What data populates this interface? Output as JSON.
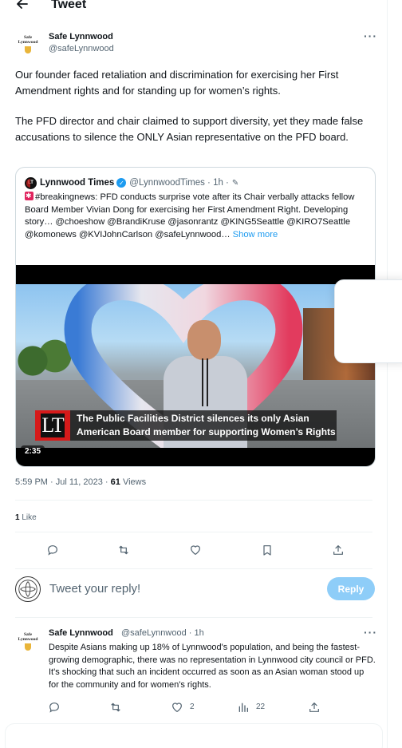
{
  "header": {
    "title": "Tweet"
  },
  "tweet": {
    "author_name": "Safe Lynnwood",
    "author_handle": "@safeLynnwood",
    "avatar_text": "Safe\nLynnwood",
    "paragraph1": "Our founder faced retaliation and discrimination for exercising her First Amendment rights and for standing up for women’s rights.",
    "paragraph2": "The PFD director and chair claimed to support diversity, yet they made false accusations to silence the ONLY Asian representative on the PFD board.",
    "time": "5:59 PM · Jul 11, 2023 · ",
    "views_count": "61",
    "views_label": " Views",
    "likes_count": "1",
    "likes_label": " Like"
  },
  "quote": {
    "logo_text": "LT",
    "name": "Lynnwood Times",
    "handle_time": "@LynnwoodTimes · 1h ·",
    "text": "#breakingnews: PFD conducts surprise vote after its Chair verbally attacks fellow Board Member Vivian Dong for exercising her First Amendment Right. Developing story… @choeshow @BrandiKruse @jasonrantz @KING5Seattle @KIRO7Seattle @komonews @KVIJohnCarlson @safeLynnwood…",
    "show_more": "Show more",
    "video_caption_line1": "The Public Facilities District silences its only Asian",
    "video_caption_line2": "American Board member  for supporting Women’s Rights",
    "video_logo": "LT",
    "duration": "2:35"
  },
  "reply_box": {
    "placeholder": "Tweet your reply!",
    "button_label": "Reply"
  },
  "reply": {
    "author_name": "Safe Lynnwood",
    "author_handle": "@safeLynnwood · 1h",
    "text": "Despite Asians making up 18% of Lynnwood's population, and being the fastest-growing demographic, there was no representation in Lynnwood city council or PFD. It's shocking that such an incident occurred as soon as an Asian woman stood up for the community and for women's rights.",
    "like_count": "2",
    "view_count": "22"
  },
  "colors": {
    "accent": "#1d9bf0",
    "reply_button_disabled": "#8ecdf8",
    "secondary_text": "#536471"
  }
}
